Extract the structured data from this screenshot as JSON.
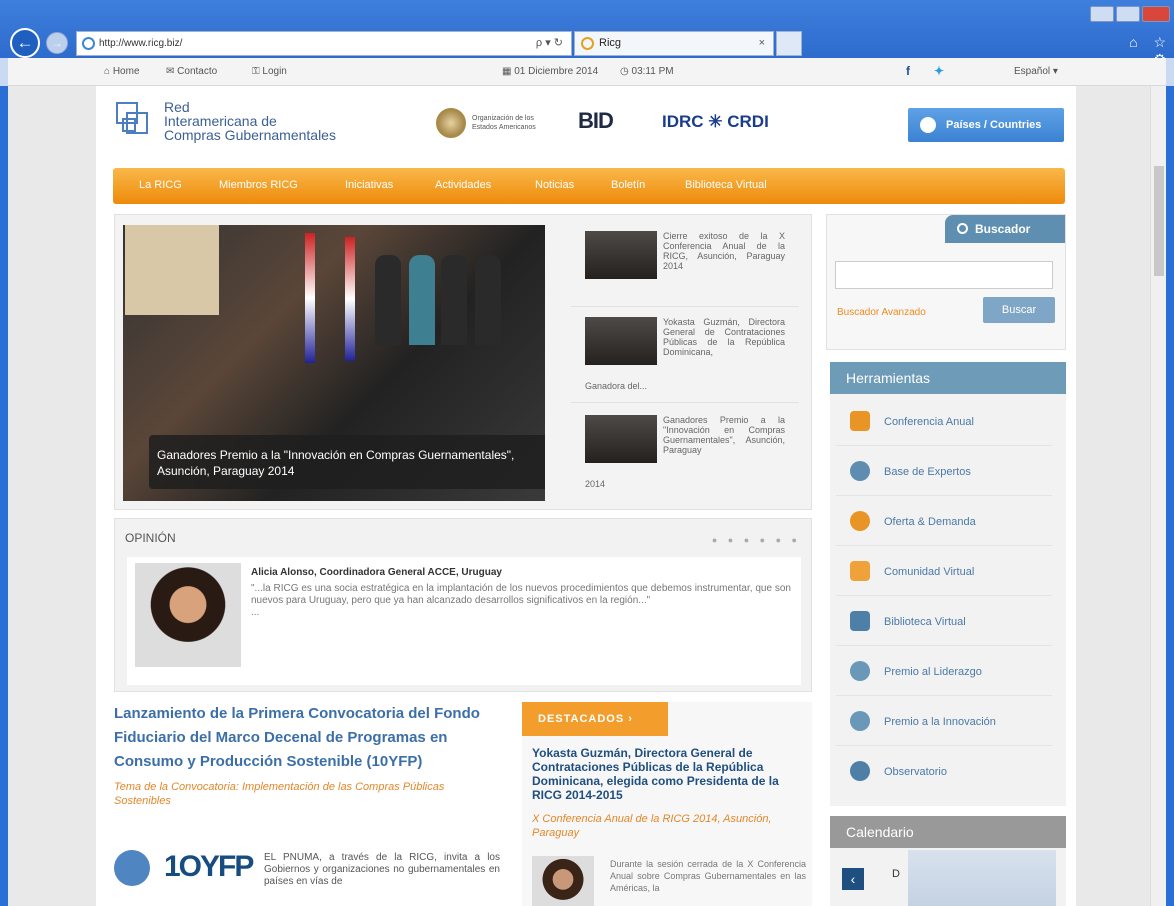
{
  "browser": {
    "url": "http://www.ricg.biz/",
    "address_tools": "ρ ▾ ↻",
    "tab_title": "Ricg",
    "tab_close": "×",
    "ie_tools_icons": "⌂ ☆ ⚙",
    "command_bar": {
      "home": "Home",
      "contact": "Contacto",
      "login": "Login",
      "date": "01 Diciembre 2014",
      "time": "03:11 PM",
      "language": "Español"
    }
  },
  "site": {
    "logo": {
      "line1": "Red",
      "line2": "Interamericana de",
      "line3": "Compras Gubernamentales"
    },
    "partners": {
      "oea_line1": "Organización de los",
      "oea_line2": "Estados Americanos",
      "bid": "BID",
      "idrc": "IDRC ✳ CRDI"
    },
    "countries_button": "Países / Countries",
    "menu": [
      "La RICG",
      "Miembros RICG",
      "Iniciativas",
      "Actividades",
      "Noticias",
      "Boletín",
      "Biblioteca Virtual"
    ],
    "hero_caption": "Ganadores Premio a la \"Innovación en Compras Guernamentales\", Asunción, Paraguay 2014",
    "news": [
      {
        "text": "Cierre exitoso de la X Conferencia Anual de la RICG, Asunción, Paraguay 2014",
        "tail": ""
      },
      {
        "text": "Yokasta Guzmán, Directora General de Contrataciones Públicas de la República Dominicana,",
        "tail": "Ganadora del..."
      },
      {
        "text": "Ganadores Premio a la \"Innovación en Compras Guernamentales\", Asunción, Paraguay",
        "tail": "2014"
      }
    ],
    "search": {
      "title": "Buscador",
      "advanced": "Buscador Avanzado",
      "button": "Buscar"
    },
    "tools": {
      "title": "Herramientas",
      "items": [
        "Conferencia Anual",
        "Base de Expertos",
        "Oferta & Demanda",
        "Comunidad Virtual",
        "Biblioteca Virtual",
        "Premio al Liderazgo",
        "Premio a la Innovación",
        "Observatorio"
      ]
    },
    "calendar": {
      "title": "Calendario",
      "prev": "‹",
      "day_initial": "D"
    },
    "opinion": {
      "title": "OPINIÓN",
      "dots": "● ● ● ● ● ●",
      "author": "Alicia Alonso, Coordinadora General ACCE, Uruguay",
      "quote": "\"...la RICG es una socia estratégica en la implantación de los nuevos procedimientos que debemos instrumentar, que son nuevos para Uruguay, pero que ya han alcanzado desarrollos significativos en la región...\"",
      "more": "..."
    },
    "article": {
      "title": "Lanzamiento de la Primera Convocatoria del Fondo Fiduciario del Marco Decenal de Programas en Consumo y Producción Sostenible (10YFP)",
      "subtitle": "Tema de la Convocatoria: Implementación de las Compras Públicas Sostenibles",
      "yfp": "1OYFP",
      "body": "EL PNUMA, a través de la RICG, invita a los Gobiernos y organizaciones no gubernamentales en países en vías de"
    },
    "featured": {
      "tab": "DESTACADOS",
      "arrow": "›",
      "title": "Yokasta Guzmán, Directora General de Contrataciones Públicas de la República Dominicana, elegida como Presidenta de la RICG 2014-2015",
      "subtitle": "X Conferencia Anual de la RICG 2014, Asunción, Paraguay",
      "body": "Durante la sesión cerrada de la X Conferencia Anual sobre Compras Gubernamentales en las Américas, la"
    }
  },
  "colors": {
    "menu": "#ee8a0a",
    "accent_orange": "#f39d2c",
    "link_blue": "#3c6fa8",
    "tools_header": "#6d9bb8",
    "countries_button": "#3b82d2"
  }
}
